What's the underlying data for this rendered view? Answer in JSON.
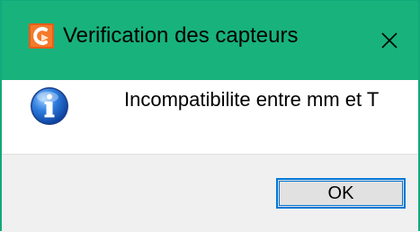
{
  "window": {
    "title": "Verification des capteurs",
    "app_icon": "app-icon",
    "close_icon": "close-icon",
    "colors": {
      "titlebar": "#18b27d",
      "border": "#14a87a",
      "footer": "#f0f0f0",
      "button_border": "#0078d7"
    }
  },
  "dialog": {
    "icon": "info-icon",
    "message": "Incompatibilite entre mm et T"
  },
  "buttons": {
    "ok_label": "OK"
  }
}
